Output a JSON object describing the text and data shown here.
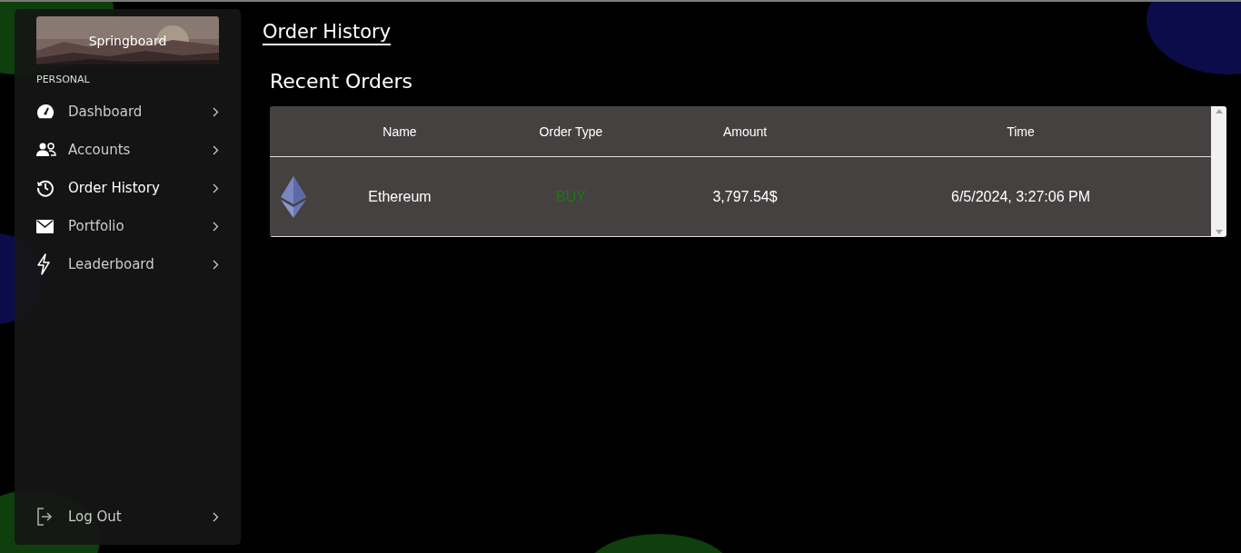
{
  "sidebar": {
    "brand": "Springboard",
    "section_label": "PERSONAL",
    "items": [
      {
        "label": "Dashboard",
        "selected": false
      },
      {
        "label": "Accounts",
        "selected": false
      },
      {
        "label": "Order History",
        "selected": true
      },
      {
        "label": "Portfolio",
        "selected": false
      },
      {
        "label": "Leaderboard",
        "selected": false
      }
    ],
    "footer_item": {
      "label": "Log Out"
    }
  },
  "page_title": "Order History",
  "section_title": "Recent Orders",
  "table": {
    "columns": [
      "Name",
      "Order Type",
      "Amount",
      "Time"
    ],
    "rows": [
      {
        "name": "Ethereum",
        "order_type": "BUY",
        "color": "#1d7a12",
        "amount": "3,797.54$",
        "time": "6/5/2024, 3:27:06 PM"
      }
    ]
  }
}
